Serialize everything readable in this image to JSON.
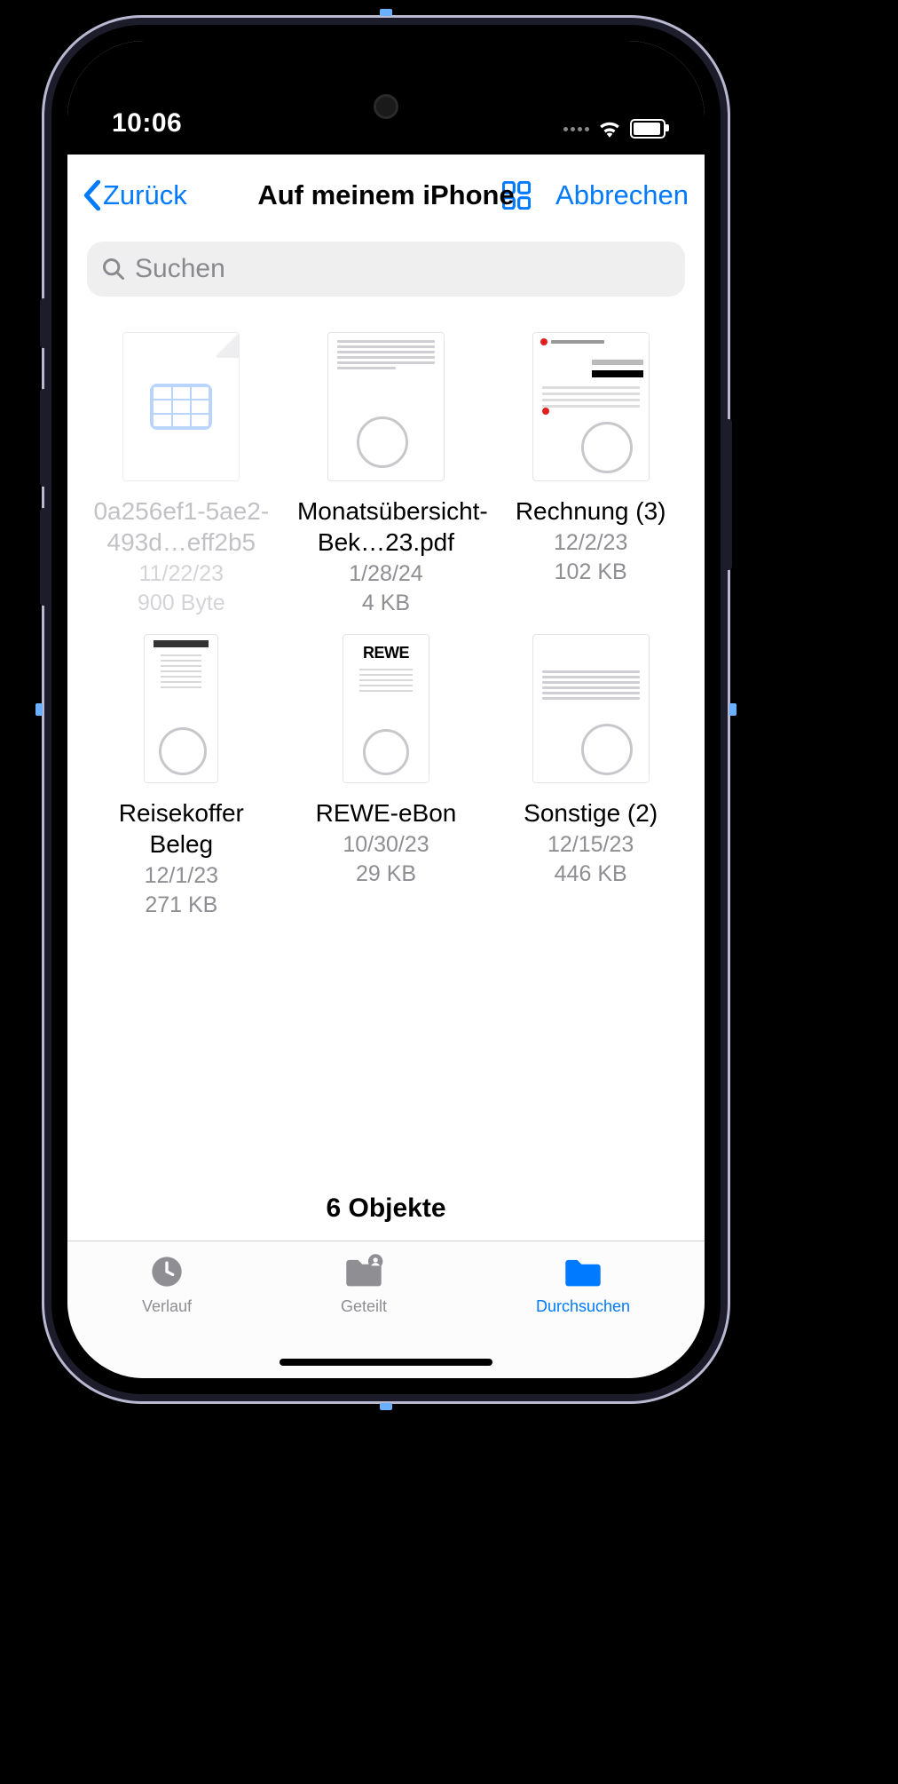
{
  "statusbar": {
    "time": "10:06"
  },
  "nav": {
    "back": "Zurück",
    "title": "Auf meinem iPhone",
    "cancel": "Abbrechen"
  },
  "search": {
    "placeholder": "Suchen"
  },
  "files": [
    {
      "name": "0a256ef1-5ae2-493d…eff2b5",
      "date": "11/22/23",
      "size": "900 Byte",
      "kind": "spreadsheet",
      "dimmed": true
    },
    {
      "name": "Monatsübersicht-Bek…23.pdf",
      "date": "1/28/24",
      "size": "4 KB",
      "kind": "doc",
      "dimmed": false
    },
    {
      "name": "Rechnung (3)",
      "date": "12/2/23",
      "size": "102 KB",
      "kind": "invoice",
      "dimmed": false
    },
    {
      "name": "Reisekoffer Beleg",
      "date": "12/1/23",
      "size": "271 KB",
      "kind": "receipt",
      "dimmed": false
    },
    {
      "name": "REWE-eBon",
      "date": "10/30/23",
      "size": "29 KB",
      "kind": "rewe",
      "dimmed": false
    },
    {
      "name": "Sonstige (2)",
      "date": "12/15/23",
      "size": "446 KB",
      "kind": "letter",
      "dimmed": false
    }
  ],
  "footer": {
    "count": "6 Objekte"
  },
  "tabs": [
    {
      "label": "Verlauf",
      "active": false,
      "icon": "clock"
    },
    {
      "label": "Geteilt",
      "active": false,
      "icon": "shared-folder"
    },
    {
      "label": "Durchsuchen",
      "active": true,
      "icon": "folder"
    }
  ]
}
